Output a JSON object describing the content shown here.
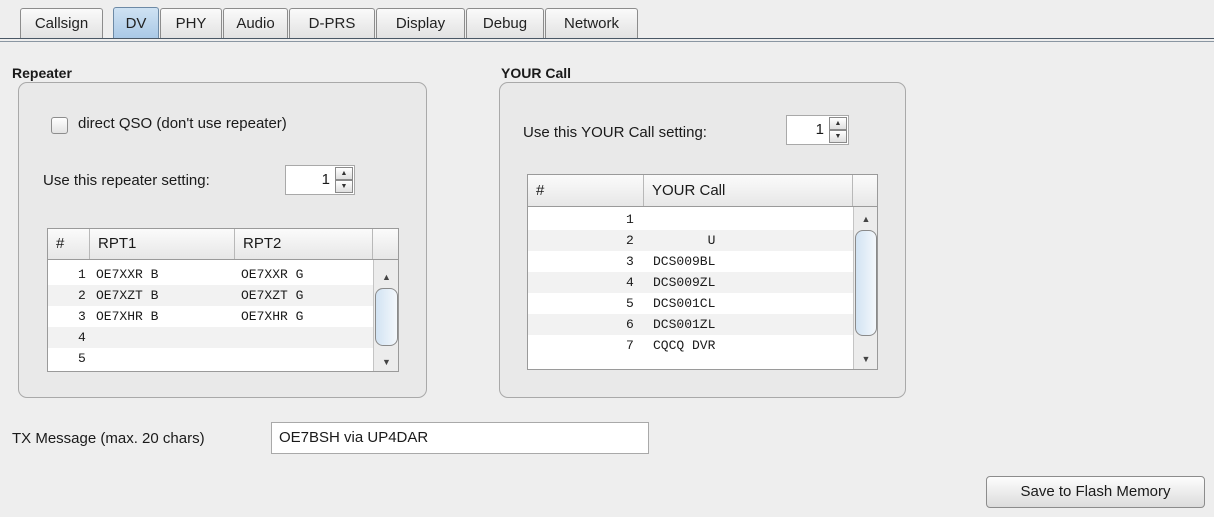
{
  "tabs": [
    {
      "label": "Callsign",
      "active": false
    },
    {
      "label": "DV",
      "active": true
    },
    {
      "label": "PHY",
      "active": false
    },
    {
      "label": "Audio",
      "active": false
    },
    {
      "label": "D-PRS",
      "active": false
    },
    {
      "label": "Display",
      "active": false
    },
    {
      "label": "Debug",
      "active": false
    },
    {
      "label": "Network",
      "active": false
    }
  ],
  "repeater": {
    "title": "Repeater",
    "direct_qso_label": "direct QSO (don't use repeater)",
    "direct_qso_checked": false,
    "setting_label": "Use this repeater setting:",
    "setting_value": "1",
    "columns": [
      "#",
      "RPT1",
      "RPT2"
    ],
    "rows": [
      [
        "1",
        "OE7XXR B",
        "OE7XXR G"
      ],
      [
        "2",
        "OE7XZT B",
        "OE7XZT G"
      ],
      [
        "3",
        "OE7XHR B",
        "OE7XHR G"
      ],
      [
        "4",
        "",
        ""
      ],
      [
        "5",
        "",
        ""
      ]
    ]
  },
  "your_call": {
    "title": "YOUR Call",
    "setting_label": "Use this YOUR Call setting:",
    "setting_value": "1",
    "columns": [
      "#",
      "YOUR Call"
    ],
    "rows": [
      [
        "1",
        ""
      ],
      [
        "2",
        "       U"
      ],
      [
        "3",
        "DCS009BL"
      ],
      [
        "4",
        "DCS009ZL"
      ],
      [
        "5",
        "DCS001CL"
      ],
      [
        "6",
        "DCS001ZL"
      ],
      [
        "7",
        "CQCQ DVR"
      ]
    ]
  },
  "tx_message": {
    "label": "TX Message (max. 20 chars)",
    "value": "OE7BSH via UP4DAR"
  },
  "save_button_label": "Save to Flash Memory",
  "icons": {
    "spinner_up": "arrow-up-icon",
    "spinner_down": "arrow-down-icon",
    "scroll_up": "scroll-up-icon",
    "scroll_down": "scroll-down-icon"
  },
  "colors": {
    "active_tab": "#a9c8e6",
    "scroll_thumb": "#d2e3f3"
  }
}
